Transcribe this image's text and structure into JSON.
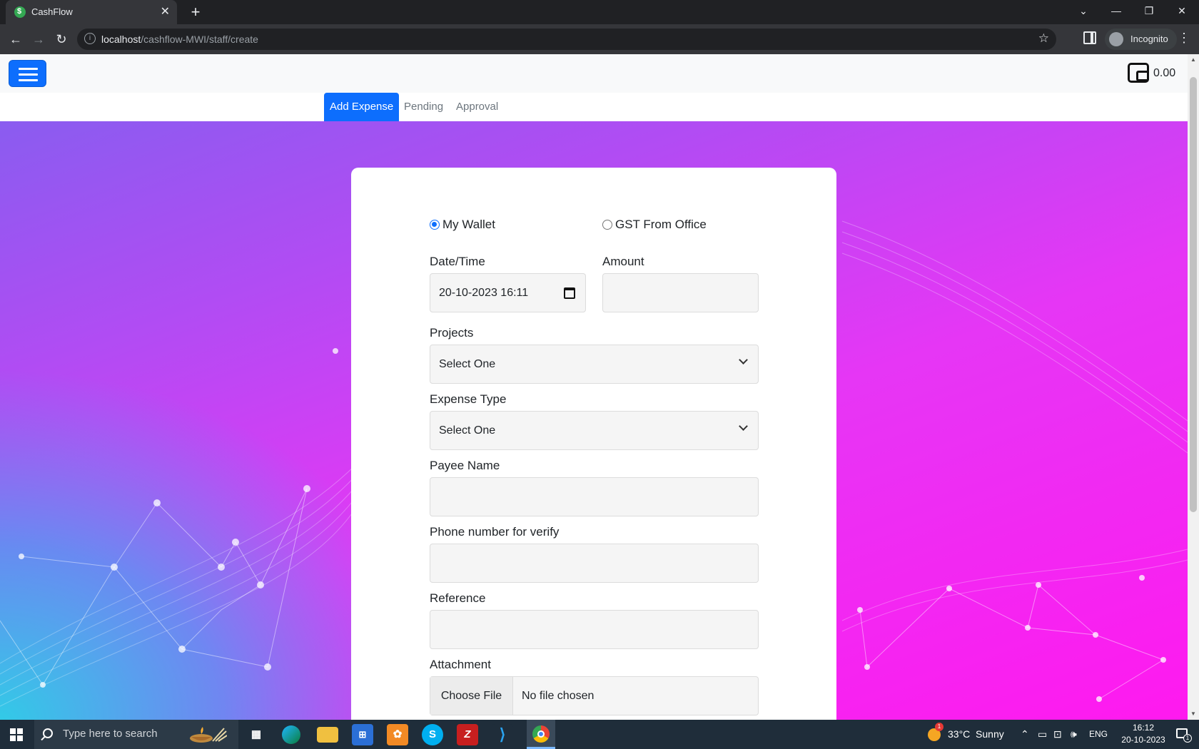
{
  "browser": {
    "tab_title": "CashFlow",
    "tab_close": "✕",
    "new_tab": "+",
    "url_host": "localhost",
    "url_path": "/cashflow-MWI/staff/create",
    "profile_label": "Incognito",
    "window_controls": [
      "⌄",
      "—",
      "❐",
      "✕"
    ]
  },
  "app": {
    "wallet_balance": "0.00",
    "tabs": [
      {
        "label": "Add Expense",
        "active": true
      },
      {
        "label": "Pending",
        "active": false
      },
      {
        "label": "Approval",
        "active": false
      }
    ]
  },
  "form": {
    "source_options": [
      {
        "label": "My Wallet",
        "checked": true
      },
      {
        "label": "GST From Office",
        "checked": false
      }
    ],
    "datetime": {
      "label": "Date/Time",
      "value": "20-10-2023 16:11"
    },
    "amount": {
      "label": "Amount",
      "value": ""
    },
    "projects": {
      "label": "Projects",
      "selected": "Select One"
    },
    "expense_type": {
      "label": "Expense Type",
      "selected": "Select One"
    },
    "payee_name": {
      "label": "Payee Name",
      "value": ""
    },
    "phone": {
      "label": "Phone number for verify",
      "value": ""
    },
    "reference": {
      "label": "Reference",
      "value": ""
    },
    "attachment": {
      "label": "Attachment",
      "button": "Choose File",
      "status": "No file chosen"
    }
  },
  "taskbar": {
    "search_placeholder": "Type here to search",
    "weather": "33°C  Sunny",
    "weather_badge": "1",
    "language": "ENG",
    "time": "16:12",
    "date": "20-10-2023",
    "notification_count": "1"
  },
  "colors": {
    "primary": "#0d6efd",
    "gradient_start": "#2fd0e6",
    "gradient_end": "#ff19ef"
  }
}
